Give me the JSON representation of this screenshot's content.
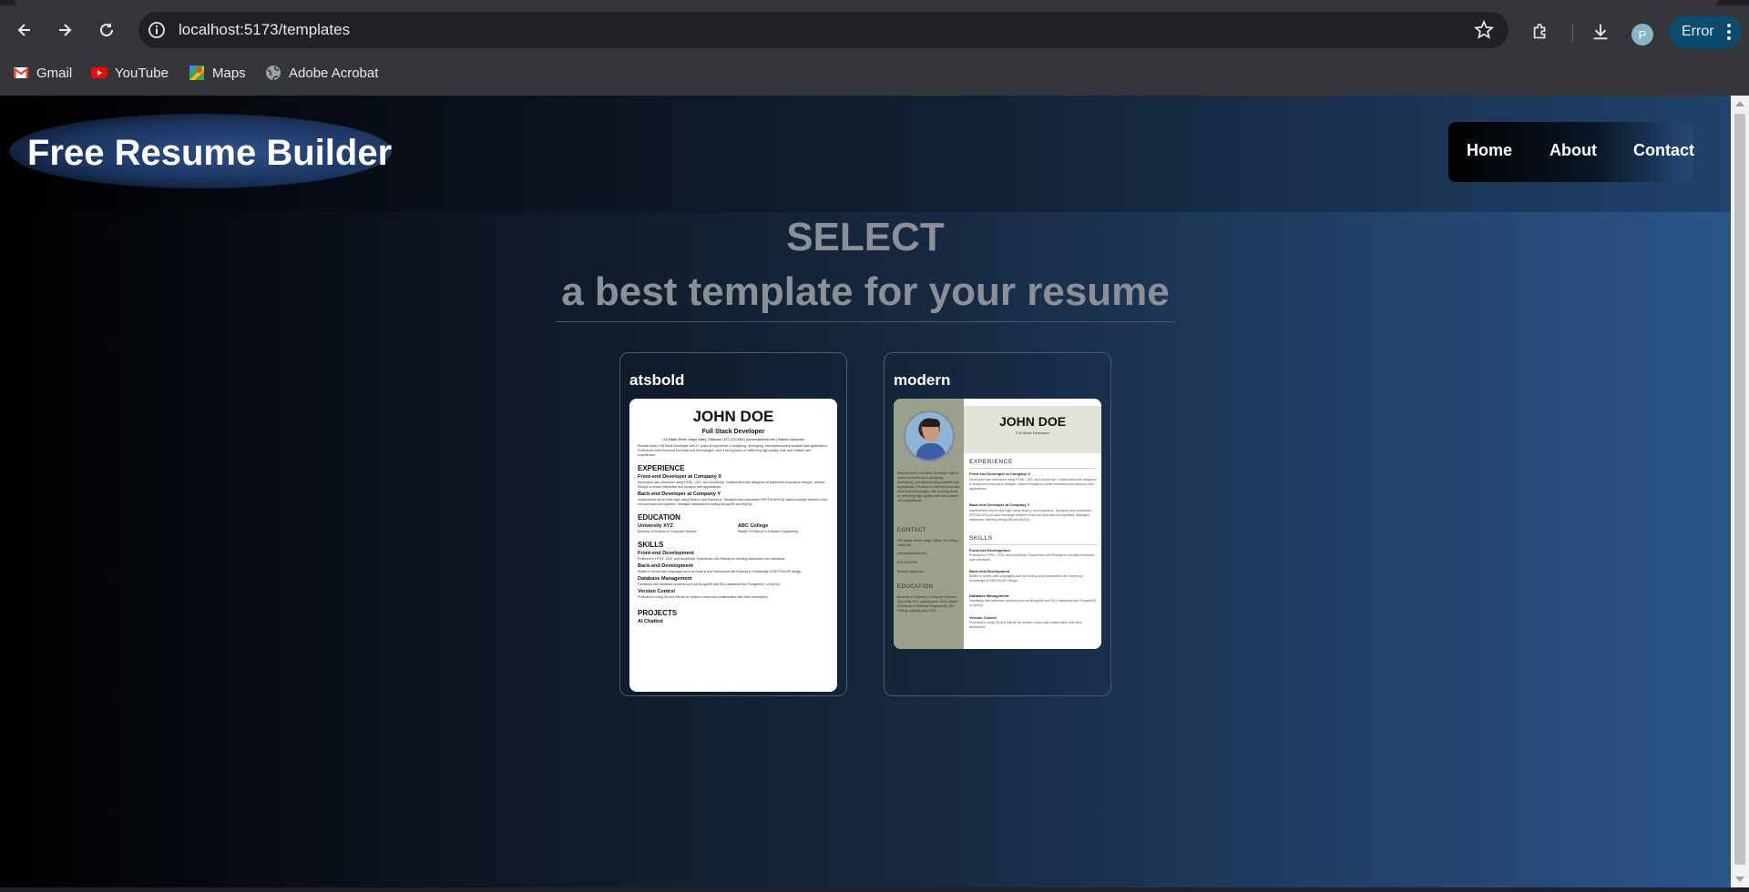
{
  "browser": {
    "url": "localhost:5173/templates",
    "profile_initial": "P",
    "status_chip": "Error",
    "bookmarks": [
      {
        "label": "Gmail",
        "icon": "gmail-icon"
      },
      {
        "label": "YouTube",
        "icon": "youtube-icon"
      },
      {
        "label": "Maps",
        "icon": "maps-icon"
      },
      {
        "label": "Adobe Acrobat",
        "icon": "globe-icon"
      }
    ]
  },
  "site": {
    "brand": "Free Resume Builder",
    "nav": [
      "Home",
      "About",
      "Contact"
    ]
  },
  "hero": {
    "line1": "SELECT",
    "line2": "a best template for your resume"
  },
  "templates": [
    {
      "title": "atsbold",
      "preview": {
        "name": "JOHN DOE",
        "role": "Full Stack Developer",
        "contact": "123 Maple Street, Indigo Valley, California | 872-123-0000 | johndoe@email.com | linkedin.in/johndoe",
        "summary": "Results-driven Full Stack Developer with 2+ years of experience in designing, developing, and implementing scalable web applications. Proficient in both front-end and back-end technologies, with a strong focus on delivering high-quality code and intuitive user experiences.",
        "experience_heading": "EXPERIENCE",
        "exp1_title": "Front-end Developer at Company X",
        "exp1_text": "Developed user interfaces using HTML, CSS, and JavaScript. Collaborated with designers to implement responsive designs. Utilized Reactjs to create interactive and dynamic web applications.",
        "exp2_title": "Back-end Developer at Company Y",
        "exp2_text": "Implemented server-side logic using Node.js and Express.js. Designed and maintained RESTful APIs for data exchange between front-end and back-end systems. Managed databases including MongoDB and MySQL.",
        "education_heading": "EDUCATION",
        "edu1_school": "University XYZ",
        "edu1_text": "Bachelor of Science in Computer Science",
        "edu2_school": "ABC College",
        "edu2_text": "Master of Science in Software Engineering",
        "skills_heading": "SKILLS",
        "skill1": "Front-end Development",
        "skill1_text": "Proficient in HTML, CSS, and JavaScript. Experience with Reactjs for building interactive user interfaces.",
        "skill2": "Back-end Development",
        "skill2_text": "Skilled in server-side languages such as Node.js and frameworks like Express.js. Knowledge of RESTful API design.",
        "skill3": "Database Management",
        "skill3_text": "Familiarity with database systems such as MongoDB and SQL databases like PostgreSQL or MySQL.",
        "skill4": "Version Control",
        "skill4_text": "Proficient in using Git and GitHub for version control and collaboration with other developers.",
        "projects_heading": "PROJECTS",
        "project1": "AI Chatbot"
      }
    },
    {
      "title": "modern",
      "preview": {
        "name": "JOHN DOE",
        "role": "Full Stack Developer",
        "summary": "Results-driven Full Stack Developer with 2+ years of experience in designing, developing, and implementing scalable web applications. Proficient in both front-end and back-end technologies, with a strong focus on delivering high-quality code and intuitive user experiences.",
        "contact_heading": "CONTACT",
        "contact_lines": [
          "123 Maple Street, Indigo Valley, San Diego, California",
          "johndoe@email.com",
          "872-123-0000",
          "linkedin.in/johndoe"
        ],
        "education_heading": "EDUCATION",
        "edu_text": "Bachelor of Science in Computer Science, University XYZ, passing year 2019. Master of Science in Software Engineering, ABC College, passing year 2021",
        "experience_heading": "EXPERIENCE",
        "exp1_title": "Front-end Developer at Company X",
        "exp1_text": "Developed user interfaces using HTML, CSS, and JavaScript. Collaborated with designers to implement responsive designs. Utilized Reactjs to create interactive and dynamic web applications.",
        "exp2_title": "Back-end Developer at Company Y",
        "exp2_text": "Implemented server-side logic using Node.js and Express.js. Designed and maintained RESTful APIs for data exchange between front-end and back-end systems. Managed databases including MongoDB and MySQL.",
        "skills_heading": "SKILLS",
        "skill1": "Front-end Development",
        "skill1_text": "Proficient in HTML, CSS, and JavaScript. Experience with Reactjs for building interactive user interfaces.",
        "skill2": "Back-end Development",
        "skill2_text": "Skilled in server-side languages such as Node.js and frameworks like Express.js. Knowledge of RESTful API design.",
        "skill3": "Database Management",
        "skill3_text": "Familiarity with database systems such as MongoDB and SQL databases like PostgreSQL or MySQL.",
        "skill4": "Version Control",
        "skill4_text": "Proficient in using Git and GitHub for version control and collaboration with other developers."
      }
    }
  ],
  "colors": {
    "page_gradient_start": "#000000",
    "page_gradient_end": "#2b5589",
    "hero_text": "#8b8f96",
    "modern_sidebar": "#9aa08c"
  }
}
